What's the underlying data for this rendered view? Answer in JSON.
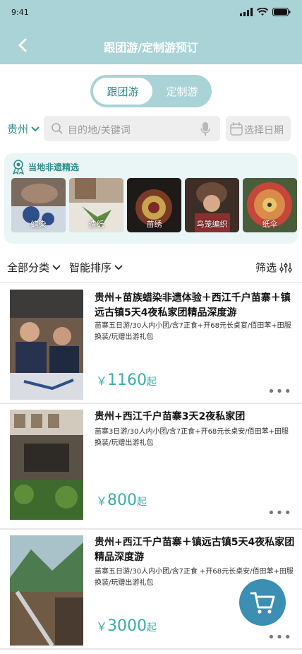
{
  "status": {
    "time": "9:41"
  },
  "header": {
    "title": "跟团游/定制游预订"
  },
  "tabs": [
    {
      "label": "跟团游"
    },
    {
      "label": "定制游"
    }
  ],
  "search": {
    "city": "贵州",
    "placeholder": "目的地/关键词",
    "date_label": "选择日期"
  },
  "heritage": {
    "title": "当地非遗精选",
    "items": [
      {
        "label": "蜡染"
      },
      {
        "label": "造纸"
      },
      {
        "label": "苗绣"
      },
      {
        "label": "鸟笼编织"
      },
      {
        "label": "纸伞"
      }
    ]
  },
  "filters": {
    "category": "全部分类",
    "sort": "智能排序",
    "filter": "筛选"
  },
  "products": [
    {
      "title": "贵州+苗族蜡染非遗体验＋西江千户苗寨＋镇远古镇5天4夜私家团精品深度游",
      "desc": "苗寨五日游/30人内小团/含7正食+开68元长桌宴/佰田苯+田服换装/玩赠出游礼包",
      "currency": "￥",
      "price": "1160",
      "suffix": "起"
    },
    {
      "title": "贵州+西江千户苗寨3天2夜私家团",
      "desc": "苗寨3日游/30人内小团/含7正食+开68元长桌安/佰田苯+田服换装/玩赠出游礼包",
      "currency": "￥",
      "price": "800",
      "suffix": "起"
    },
    {
      "title": "贵州+西江千户苗寨＋镇远古镇5天4夜私家团精品深度游",
      "desc": "苗寨五日游/30人内小团/含7正食 +开68元长桌安/佰田苯+田服换装/玩赠出游礼包",
      "currency": "￥",
      "price": "3000",
      "suffix": "起"
    }
  ],
  "colors": {
    "accent": "#3aaea9",
    "header": "#a9d3d6",
    "cart": "#3a8fb3"
  }
}
